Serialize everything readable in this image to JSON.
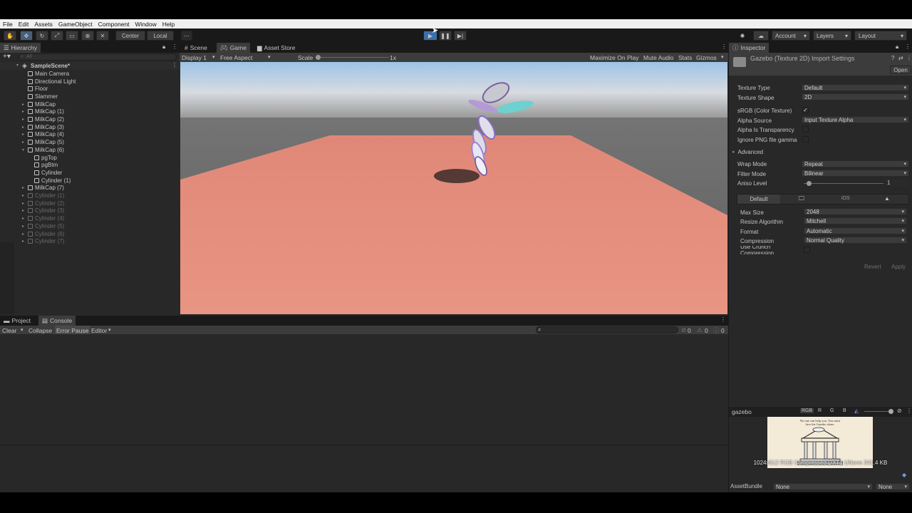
{
  "menu": [
    "File",
    "Edit",
    "Assets",
    "GameObject",
    "Component",
    "Window",
    "Help"
  ],
  "toolbar": {
    "center_label": "Center",
    "local_label": "Local",
    "account_label": "Account",
    "layers_label": "Layers",
    "layout_label": "Layout"
  },
  "hierarchy": {
    "tab_label": "Hierarchy",
    "search_placeholder": "All",
    "scene_name": "SampleScene*",
    "items": [
      {
        "label": "Main Camera",
        "depth": 1,
        "arrow": "",
        "dim": false
      },
      {
        "label": "Directional Light",
        "depth": 1,
        "arrow": "",
        "dim": false
      },
      {
        "label": "Floor",
        "depth": 1,
        "arrow": "",
        "dim": false
      },
      {
        "label": "Slammer",
        "depth": 1,
        "arrow": "",
        "dim": false
      },
      {
        "label": "MilkCap",
        "depth": 1,
        "arrow": "▸",
        "dim": false
      },
      {
        "label": "MilkCap (1)",
        "depth": 1,
        "arrow": "▸",
        "dim": false
      },
      {
        "label": "MilkCap (2)",
        "depth": 1,
        "arrow": "▸",
        "dim": false
      },
      {
        "label": "MilkCap (3)",
        "depth": 1,
        "arrow": "▸",
        "dim": false
      },
      {
        "label": "MilkCap (4)",
        "depth": 1,
        "arrow": "▸",
        "dim": false
      },
      {
        "label": "MilkCap (5)",
        "depth": 1,
        "arrow": "▸",
        "dim": false
      },
      {
        "label": "MilkCap (6)",
        "depth": 1,
        "arrow": "▾",
        "dim": false
      },
      {
        "label": "pgTop",
        "depth": 2,
        "arrow": "",
        "dim": false
      },
      {
        "label": "pgBtm",
        "depth": 2,
        "arrow": "",
        "dim": false
      },
      {
        "label": "Cylinder",
        "depth": 2,
        "arrow": "",
        "dim": false
      },
      {
        "label": "Cylinder (1)",
        "depth": 2,
        "arrow": "",
        "dim": false
      },
      {
        "label": "MilkCap (7)",
        "depth": 1,
        "arrow": "▸",
        "dim": false
      },
      {
        "label": "Cylinder (1)",
        "depth": 1,
        "arrow": "▸",
        "dim": true
      },
      {
        "label": "Cylinder (2)",
        "depth": 1,
        "arrow": "▸",
        "dim": true
      },
      {
        "label": "Cylinder (3)",
        "depth": 1,
        "arrow": "▸",
        "dim": true
      },
      {
        "label": "Cylinder (4)",
        "depth": 1,
        "arrow": "▸",
        "dim": true
      },
      {
        "label": "Cylinder (5)",
        "depth": 1,
        "arrow": "▸",
        "dim": true
      },
      {
        "label": "Cylinder (6)",
        "depth": 1,
        "arrow": "▸",
        "dim": true
      },
      {
        "label": "Cylinder (7)",
        "depth": 1,
        "arrow": "▸",
        "dim": true
      }
    ]
  },
  "view_tabs": {
    "scene": "Scene",
    "game": "Game",
    "asset_store": "Asset Store"
  },
  "game_bar": {
    "display": "Display 1",
    "aspect": "Free Aspect",
    "scale_label": "Scale",
    "scale_value": "1x",
    "maximize": "Maximize On Play",
    "mute": "Mute Audio",
    "stats": "Stats",
    "gizmos": "Gizmos"
  },
  "bottom": {
    "project_tab": "Project",
    "console_tab": "Console",
    "clear": "Clear",
    "collapse": "Collapse",
    "error_pause": "Error Pause",
    "editor": "Editor",
    "count_errors": "0",
    "count_warnings": "0",
    "count_messages": "0"
  },
  "inspector": {
    "tab_label": "Inspector",
    "title": "Gazebo (Texture 2D) Import Settings",
    "open": "Open",
    "fields": {
      "texture_type": {
        "label": "Texture Type",
        "value": "Default"
      },
      "texture_shape": {
        "label": "Texture Shape",
        "value": "2D"
      },
      "srgb": {
        "label": "sRGB (Color Texture)",
        "checked": true
      },
      "alpha_source": {
        "label": "Alpha Source",
        "value": "Input Texture Alpha"
      },
      "alpha_transparency": {
        "label": "Alpha Is Transparency"
      },
      "ignore_png": {
        "label": "Ignore PNG file gamma"
      },
      "advanced": {
        "label": "Advanced"
      },
      "wrap_mode": {
        "label": "Wrap Mode",
        "value": "Repeat"
      },
      "filter_mode": {
        "label": "Filter Mode",
        "value": "Bilinear"
      },
      "aniso": {
        "label": "Aniso Level",
        "value": "1"
      }
    },
    "platform": {
      "default_tab": "Default",
      "ios_tab": "iOS",
      "max_size": {
        "label": "Max Size",
        "value": "2048"
      },
      "resize": {
        "label": "Resize Algorithm",
        "value": "Mitchell"
      },
      "format": {
        "label": "Format",
        "value": "Automatic"
      },
      "compression": {
        "label": "Compression",
        "value": "Normal Quality"
      },
      "crunch": {
        "label": "Use Crunch Compression"
      }
    },
    "revert": "Revert",
    "apply": "Apply",
    "preview": {
      "name": "gazebo",
      "channels": [
        "RGB",
        "R",
        "G",
        "B"
      ],
      "info": "1024x512  RGB Compressed DXT1 UNorm   341.4 KB",
      "caption": "No one can help you. You must face the Gazebo alone."
    },
    "assetbundle": {
      "label": "AssetBundle",
      "value": "None",
      "variant": "None"
    }
  }
}
